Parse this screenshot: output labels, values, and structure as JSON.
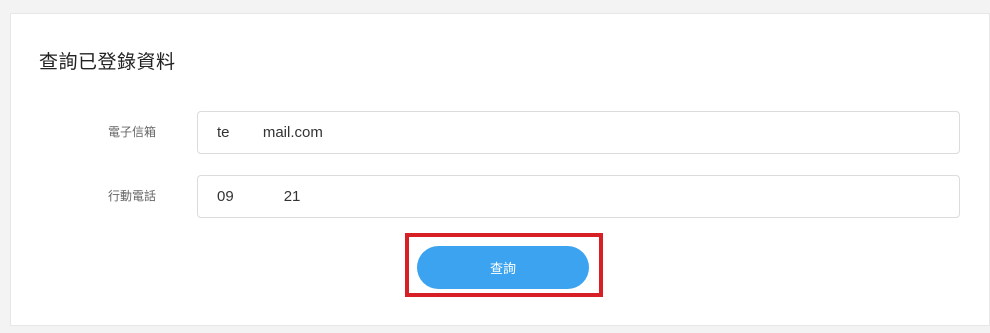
{
  "form": {
    "title": "查詢已登錄資料",
    "email": {
      "label": "電子信箱",
      "value": "te        mail.com"
    },
    "phone": {
      "label": "行動電話",
      "value": "09            21"
    },
    "submit_label": "查詢"
  },
  "colors": {
    "button": "#3ba3f0",
    "highlight": "#d71f26"
  }
}
